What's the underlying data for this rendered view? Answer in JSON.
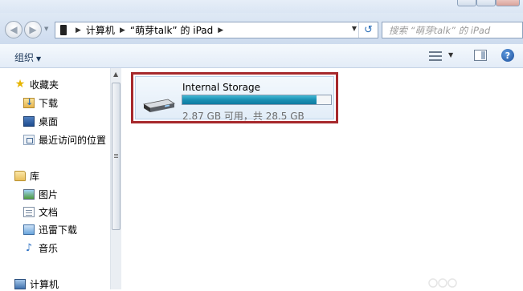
{
  "address_bar": {
    "back_label": "Back",
    "forward_label": "Forward",
    "segments": [
      "计算机",
      "“萌芽talk” 的 iPad"
    ],
    "refresh_label": "Refresh"
  },
  "search": {
    "placeholder": "搜索 “萌芽talk” 的 iPad"
  },
  "toolbar": {
    "organize_label": "组织"
  },
  "nav_pane": {
    "favorites": {
      "label": "收藏夹",
      "items": [
        "下载",
        "桌面",
        "最近访问的位置"
      ]
    },
    "libraries": {
      "label": "库",
      "items": [
        "图片",
        "文档",
        "迅雷下载",
        "音乐"
      ]
    },
    "computer_label": "计算机"
  },
  "content": {
    "drive": {
      "name": "Internal Storage",
      "info": "2.87 GB 可用，共 28.5 GB",
      "used_fraction": 0.9
    }
  },
  "colors": {
    "highlight_border": "#a6282c",
    "capacity_fill": "#1a8fb3"
  }
}
